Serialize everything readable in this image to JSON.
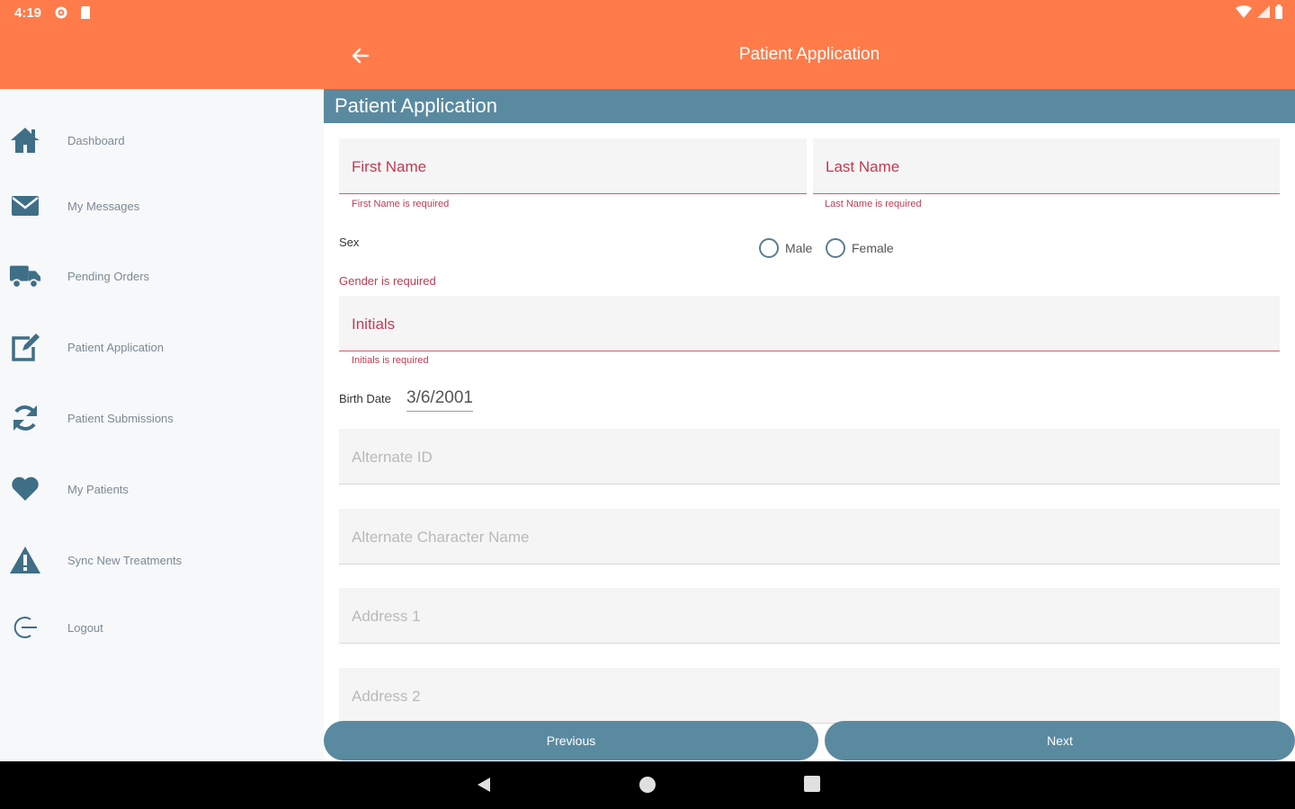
{
  "status_bar": {
    "time": "4:19"
  },
  "app_bar": {
    "title": "Patient Application"
  },
  "sidebar": {
    "items": [
      {
        "label": "Dashboard",
        "icon": "home-icon"
      },
      {
        "label": "My Messages",
        "icon": "envelope-icon"
      },
      {
        "label": "Pending Orders",
        "icon": "truck-icon"
      },
      {
        "label": "Patient Application",
        "icon": "edit-icon"
      },
      {
        "label": "Patient Submissions",
        "icon": "sync-icon"
      },
      {
        "label": "My Patients",
        "icon": "heart-icon"
      },
      {
        "label": "Sync New Treatments",
        "icon": "warning-icon"
      },
      {
        "label": "Logout",
        "icon": "logout-icon"
      }
    ]
  },
  "form": {
    "section_title": "Patient Application",
    "first_name": {
      "placeholder": "First Name",
      "error": "First Name is required"
    },
    "last_name": {
      "placeholder": "Last Name",
      "error": "Last Name is required"
    },
    "sex": {
      "label": "Sex",
      "options": [
        "Male",
        "Female"
      ],
      "error": "Gender is required"
    },
    "initials": {
      "placeholder": "Initials",
      "error": "Initials is required"
    },
    "birth_date": {
      "label": "Birth Date",
      "value": "3/6/2001"
    },
    "alternate_id": {
      "placeholder": "Alternate ID"
    },
    "alternate_character_name": {
      "placeholder": "Alternate Character Name"
    },
    "address1": {
      "placeholder": "Address 1"
    },
    "address2": {
      "placeholder": "Address 2"
    }
  },
  "buttons": {
    "previous": "Previous",
    "next": "Next"
  },
  "colors": {
    "app_bar": "#ff7b4a",
    "accent": "#5a8aa0",
    "error": "#c23a52",
    "icon": "#3f6f86"
  }
}
